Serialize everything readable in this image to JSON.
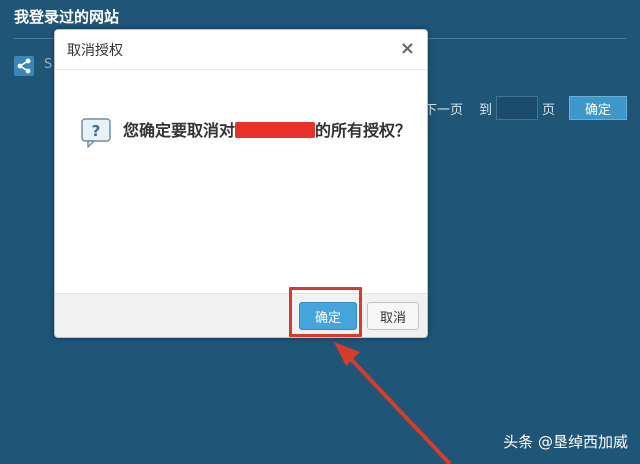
{
  "page": {
    "title": "我登录过的网站",
    "share_label": "S"
  },
  "pager": {
    "next_label": "下一页",
    "to_label": "到",
    "page_value": "",
    "page_unit": "页",
    "go_label": "确定"
  },
  "dialog": {
    "title": "取消授权",
    "close_label": "×",
    "message_prefix": "您确定要取消对",
    "message_suffix": "的所有授权？",
    "confirm_label": "确定",
    "cancel_label": "取消"
  },
  "watermark": "头条 @垦绰西加威",
  "colors": {
    "background": "#1f5577",
    "primary_button": "#46a4dd",
    "annotation": "#d73b2b",
    "redaction": "#e8312a"
  },
  "icons": {
    "share": "share-icon",
    "question": "question-icon",
    "close": "close-icon"
  }
}
